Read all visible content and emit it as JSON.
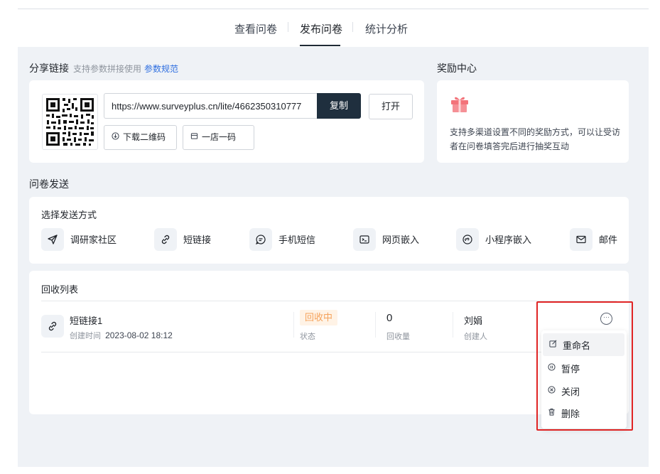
{
  "tabs": [
    {
      "label": "查看问卷",
      "active": false
    },
    {
      "label": "发布问卷",
      "active": true
    },
    {
      "label": "统计分析",
      "active": false
    }
  ],
  "share": {
    "title": "分享链接",
    "subtitle": "支持参数拼接使用",
    "param_link": "参数规范",
    "url": "https://www.surveyplus.cn/lite/4662350310777",
    "copy_label": "复制",
    "open_label": "打开",
    "download_qr_label": "下载二维码",
    "one_store_label": "一店一码"
  },
  "reward": {
    "title": "奖励中心",
    "icon": "gift-icon",
    "description": "支持多渠道设置不同的奖励方式，可以让受访者在问卷填答完后进行抽奖互动"
  },
  "send": {
    "title": "问卷发送",
    "methods_title": "选择发送方式",
    "methods": [
      {
        "label": "调研家社区",
        "icon": "paper-plane-icon"
      },
      {
        "label": "短链接",
        "icon": "link-icon"
      },
      {
        "label": "手机短信",
        "icon": "sms-icon"
      },
      {
        "label": "网页嵌入",
        "icon": "terminal-icon"
      },
      {
        "label": "小程序嵌入",
        "icon": "miniprogram-icon"
      },
      {
        "label": "邮件",
        "icon": "mail-icon"
      }
    ]
  },
  "collection": {
    "title": "回收列表",
    "row": {
      "name": "短链接1",
      "created_label": "创建时间",
      "created_time": "2023-08-02 18:12",
      "status": "回收中",
      "status_label": "状态",
      "count": "0",
      "count_label": "回收量",
      "creator": "刘娟",
      "creator_label": "创建人"
    }
  },
  "menu": {
    "items": [
      {
        "label": "重命名",
        "icon": "edit-icon"
      },
      {
        "label": "暂停",
        "icon": "pause-icon"
      },
      {
        "label": "关闭",
        "icon": "close-circle-icon"
      },
      {
        "label": "删除",
        "icon": "trash-icon"
      }
    ]
  },
  "colors": {
    "accent": "#1f2f3e",
    "link": "#2f6fe0",
    "status_text": "#f5a35c",
    "status_bg": "#fff3e6",
    "highlight": "#e02424",
    "gift": "#f3737a"
  }
}
